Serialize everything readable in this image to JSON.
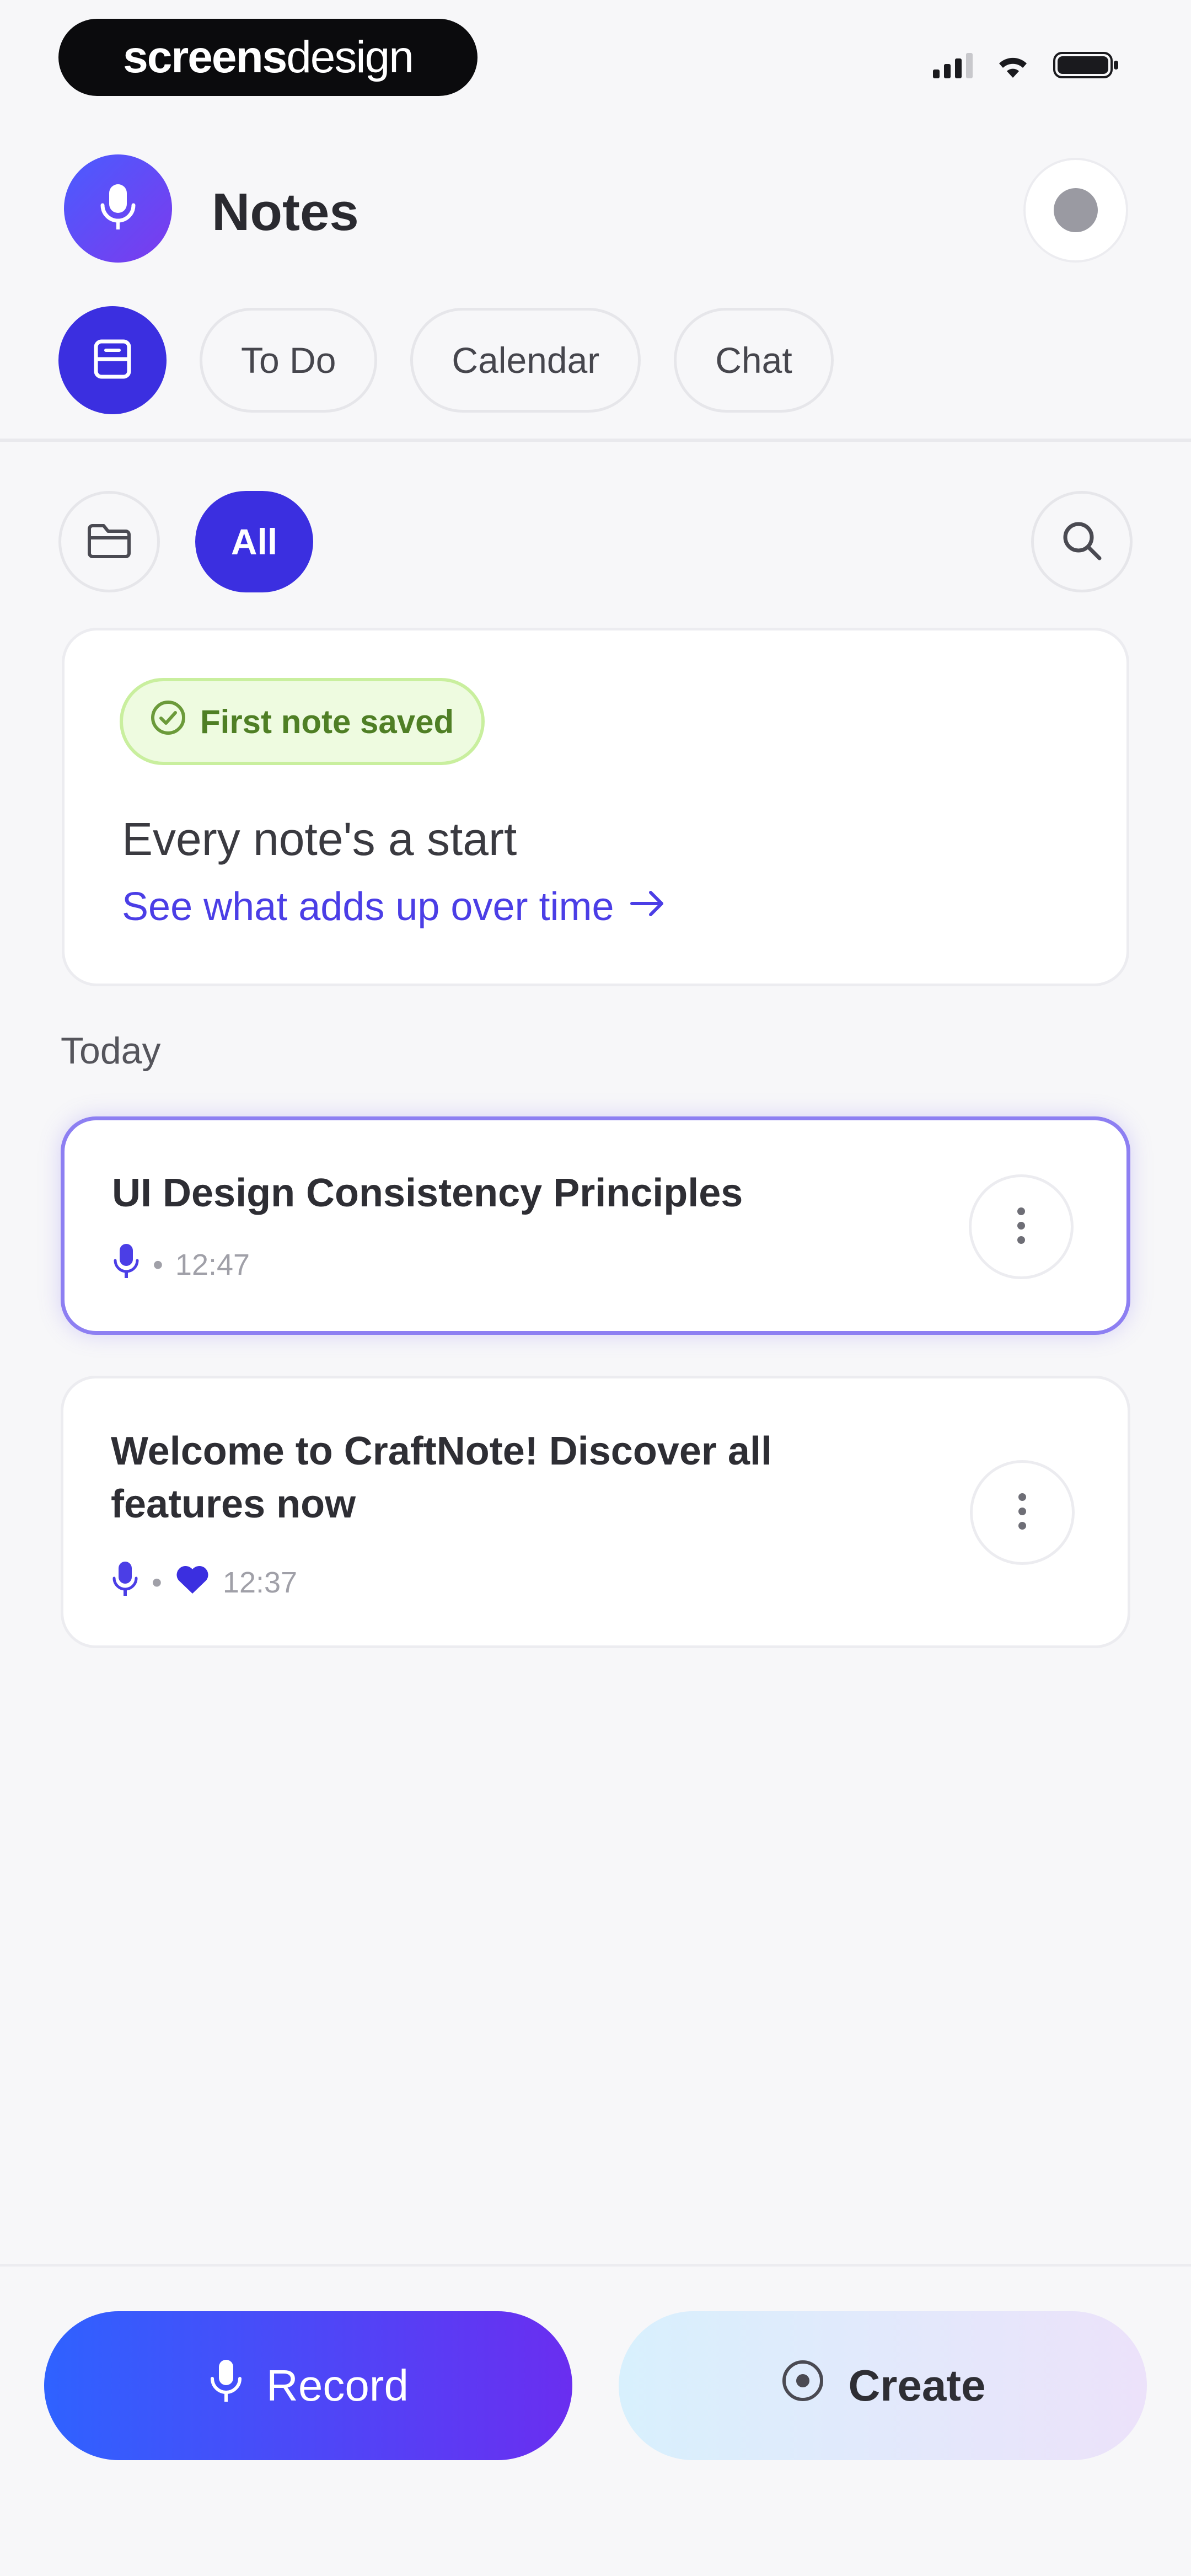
{
  "status_bar": {
    "brand_bold": "screens",
    "brand_light": "design",
    "icons": [
      "signal-icon",
      "wifi-icon",
      "battery-icon"
    ]
  },
  "header": {
    "title": "Notes",
    "logo_icon": "microphone-icon",
    "profile_icon": "profile-icon"
  },
  "tabs": {
    "active_icon": "notes-icon",
    "items": [
      "To Do",
      "Calendar",
      "Chat"
    ]
  },
  "filters": {
    "folder_icon": "folder-icon",
    "active_filter": "All",
    "search_icon": "search-icon"
  },
  "promo": {
    "badge": "First note saved",
    "badge_icon": "check-circle-icon",
    "heading": "Every note's a start",
    "link": "See what adds up over time"
  },
  "notes_section": {
    "label": "Today",
    "notes": [
      {
        "title": "UI Design Consistency Principles",
        "time": "12:47",
        "icons": [
          "microphone-icon"
        ]
      },
      {
        "title": "Welcome to CraftNote! Discover all features now",
        "time": "12:37",
        "icons": [
          "microphone-icon",
          "heart-icon"
        ]
      }
    ]
  },
  "bottom_bar": {
    "record_label": "Record",
    "create_label": "Create"
  },
  "colors": {
    "accent": "#3b2fe0",
    "link": "#4b3ee6",
    "badge_text": "#4f7f25",
    "badge_bg": "#eefbe0"
  }
}
